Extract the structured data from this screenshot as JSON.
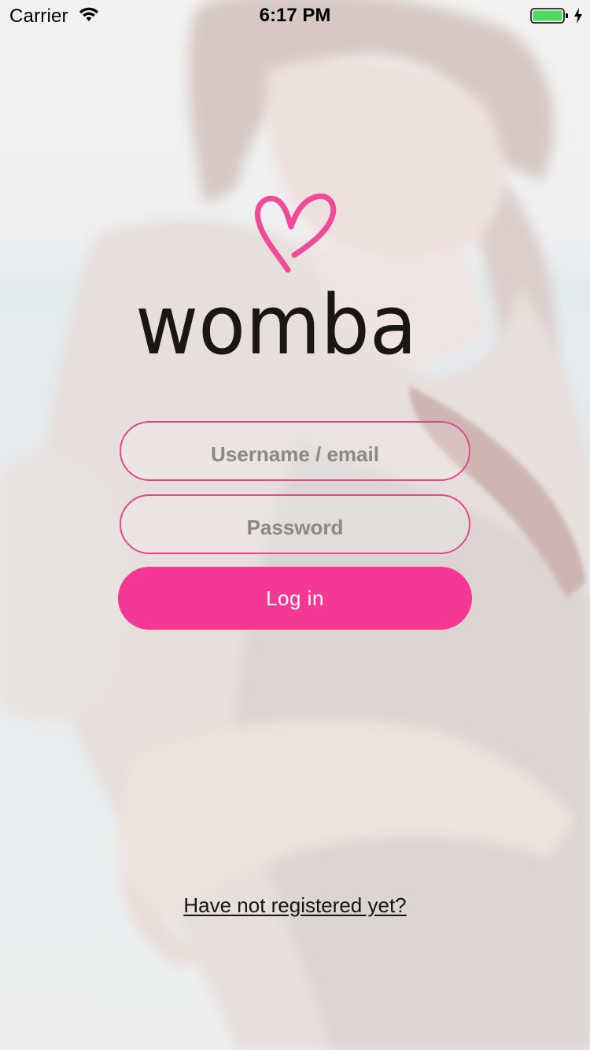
{
  "status_bar": {
    "carrier": "Carrier",
    "time": "6:17 PM",
    "wifi_icon": "wifi-icon",
    "battery_icon": "battery-full-icon",
    "charging_icon": "bolt-icon",
    "battery_level": 1.0,
    "battery_color": "#4cd964"
  },
  "brand": {
    "name": "womba",
    "logo_icon": "heart-icon",
    "accent_color": "#f53893"
  },
  "login_form": {
    "username_placeholder": "Username / email",
    "password_placeholder": "Password",
    "login_label": "Log in"
  },
  "register": {
    "link_label": "Have not registered yet?"
  }
}
